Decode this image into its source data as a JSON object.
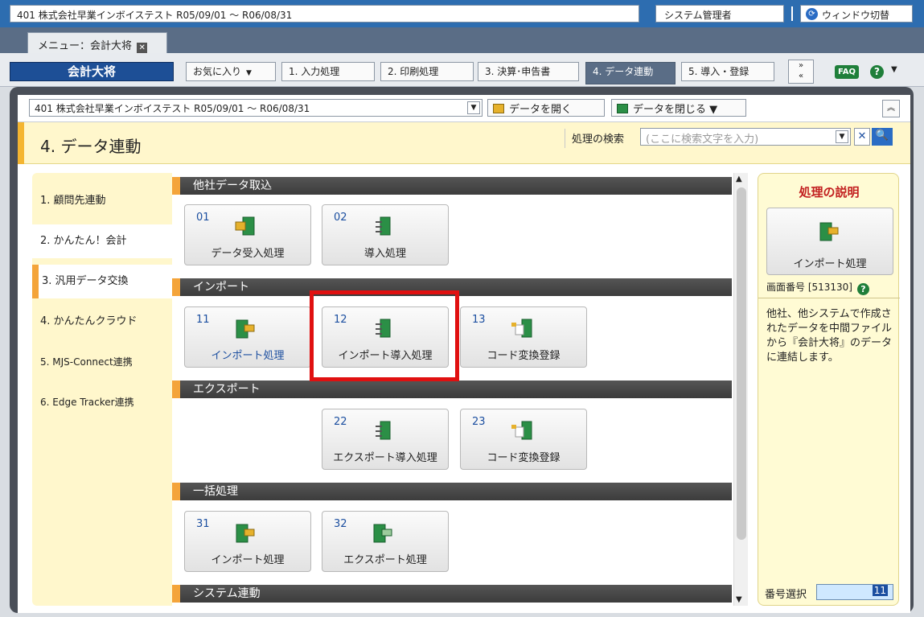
{
  "topbar": {
    "company": "401 株式会社早業インボイステスト R05/09/01 ～ R06/08/31",
    "user": "システム管理者",
    "window_switch": "ウィンドウ切替"
  },
  "tabs": {
    "menu_tab": "メニュー：会計大将"
  },
  "nav": {
    "brand": "会計大将",
    "favorites": "お気に入り",
    "items": [
      "1. 入力処理",
      "2. 印刷処理",
      "3. 決算･申告書",
      "4. データ連動",
      "5. 導入・登録"
    ],
    "faq": "FAQ",
    "help": "?"
  },
  "docbar": {
    "document": "401 株式会社早業インボイステスト R05/09/01 ～ R06/08/31",
    "open": "データを開く",
    "close": "データを閉じる"
  },
  "title": {
    "page_title": "4. データ連動",
    "search_label": "処理の検索",
    "search_placeholder": "(ここに検索文字を入力)"
  },
  "leftnav": {
    "items": [
      "1. 顧問先連動",
      "2. かんたん！会計",
      "3. 汎用データ交換",
      "4. かんたんクラウド",
      "5. MJS-Connect連携",
      "6. Edge Tracker連携"
    ]
  },
  "sections": {
    "s1": "他社データ取込",
    "s2": "インポート",
    "s3": "エクスポート",
    "s4": "一括処理",
    "s5": "システム連動"
  },
  "tiles": {
    "t01": {
      "num": "01",
      "label": "データ受入処理"
    },
    "t02": {
      "num": "02",
      "label": "導入処理"
    },
    "t11": {
      "num": "11",
      "label": "インポート処理"
    },
    "t12": {
      "num": "12",
      "label": "インポート導入処理"
    },
    "t13": {
      "num": "13",
      "label": "コード変換登録"
    },
    "t22": {
      "num": "22",
      "label": "エクスポート導入処理"
    },
    "t23": {
      "num": "23",
      "label": "コード変換登録"
    },
    "t31": {
      "num": "31",
      "label": "インポート処理"
    },
    "t32": {
      "num": "32",
      "label": "エクスポート処理"
    }
  },
  "description": {
    "title": "処理の説明",
    "tile_label": "インポート処理",
    "screen_no": "画面番号 [513130]",
    "text": "他社、他システムで作成されたデータを中間ファイルから『会計大将』のデータに連結します。",
    "number_select_label": "番号選択",
    "number_select_value": "11"
  },
  "colors": {
    "accent": "#f4a43a",
    "brand": "#1d4f96",
    "highlight": "#e01010"
  }
}
